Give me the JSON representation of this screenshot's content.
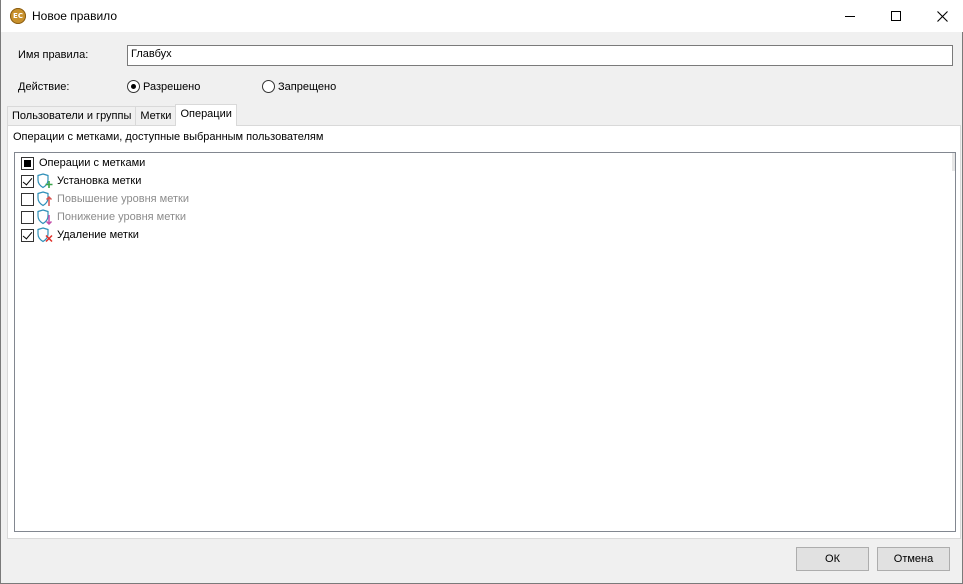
{
  "window": {
    "title": "Новое правило",
    "app_icon_text": "EC"
  },
  "form": {
    "name_label": "Имя правила:",
    "name_value": "Главбух",
    "action_label": "Действие:",
    "action_options": [
      {
        "label": "Разрешено",
        "selected": true
      },
      {
        "label": "Запрещено",
        "selected": false
      }
    ]
  },
  "tabs": [
    {
      "label": "Пользователи и группы",
      "active": false
    },
    {
      "label": "Метки",
      "active": false
    },
    {
      "label": "Операции",
      "active": true
    }
  ],
  "operations": {
    "caption": "Операции с метками, доступные выбранным пользователям",
    "root": {
      "label": "Операции с метками",
      "state": "partial"
    },
    "items": [
      {
        "label": "Установка метки",
        "checked": true,
        "enabled": true,
        "icon": "shield-plus-icon"
      },
      {
        "label": "Повышение уровня метки",
        "checked": false,
        "enabled": false,
        "icon": "shield-arrow-up-icon"
      },
      {
        "label": "Понижение уровня метки",
        "checked": false,
        "enabled": false,
        "icon": "shield-arrow-down-icon"
      },
      {
        "label": "Удаление метки",
        "checked": true,
        "enabled": true,
        "icon": "shield-cross-icon"
      }
    ]
  },
  "buttons": {
    "ok": "ОК",
    "cancel": "Отмена"
  },
  "colors": {
    "shield": "#2e8fb8",
    "plus": "#3aa34a",
    "arrow_up": "#d9534f",
    "arrow_down": "#c24fa8",
    "cross": "#e0302a"
  }
}
